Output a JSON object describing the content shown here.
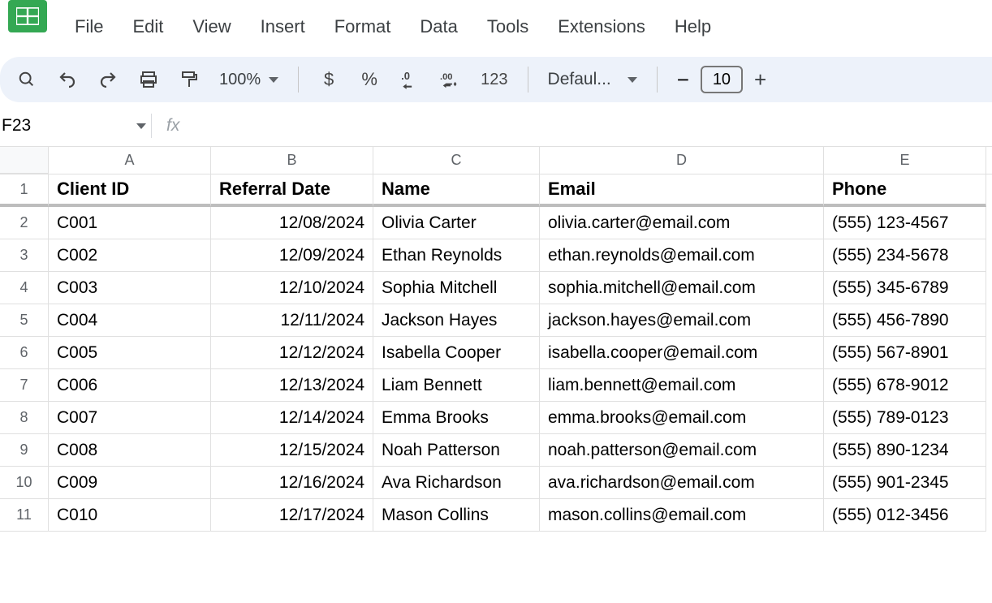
{
  "menu": [
    "File",
    "Edit",
    "View",
    "Insert",
    "Format",
    "Data",
    "Tools",
    "Extensions",
    "Help"
  ],
  "toolbar": {
    "zoom": "100%",
    "currency": "$",
    "percent": "%",
    "number_label": "123",
    "font_name": "Defaul...",
    "font_size": "10",
    "minus": "−",
    "plus": "+"
  },
  "namebox": {
    "cell_ref": "F23",
    "fx_label": "fx"
  },
  "columns": [
    "A",
    "B",
    "C",
    "D",
    "E"
  ],
  "header_row": [
    "Client ID",
    "Referral Date",
    "Name",
    "Email",
    "Phone"
  ],
  "rows": [
    {
      "n": "2",
      "a": "C001",
      "b": "12/08/2024",
      "c": "Olivia Carter",
      "d": "olivia.carter@email.com",
      "e": "(555) 123-4567"
    },
    {
      "n": "3",
      "a": "C002",
      "b": "12/09/2024",
      "c": "Ethan Reynolds",
      "d": "ethan.reynolds@email.com",
      "e": "(555) 234-5678"
    },
    {
      "n": "4",
      "a": "C003",
      "b": "12/10/2024",
      "c": "Sophia Mitchell",
      "d": "sophia.mitchell@email.com",
      "e": "(555) 345-6789"
    },
    {
      "n": "5",
      "a": "C004",
      "b": "12/11/2024",
      "c": "Jackson Hayes",
      "d": "jackson.hayes@email.com",
      "e": "(555) 456-7890"
    },
    {
      "n": "6",
      "a": "C005",
      "b": "12/12/2024",
      "c": "Isabella Cooper",
      "d": "isabella.cooper@email.com",
      "e": "(555) 567-8901"
    },
    {
      "n": "7",
      "a": "C006",
      "b": "12/13/2024",
      "c": "Liam Bennett",
      "d": "liam.bennett@email.com",
      "e": "(555) 678-9012"
    },
    {
      "n": "8",
      "a": "C007",
      "b": "12/14/2024",
      "c": "Emma Brooks",
      "d": "emma.brooks@email.com",
      "e": "(555) 789-0123"
    },
    {
      "n": "9",
      "a": "C008",
      "b": "12/15/2024",
      "c": "Noah Patterson",
      "d": "noah.patterson@email.com",
      "e": "(555) 890-1234"
    },
    {
      "n": "10",
      "a": "C009",
      "b": "12/16/2024",
      "c": "Ava Richardson",
      "d": "ava.richardson@email.com",
      "e": "(555) 901-2345"
    },
    {
      "n": "11",
      "a": "C010",
      "b": "12/17/2024",
      "c": "Mason Collins",
      "d": "mason.collins@email.com",
      "e": "(555) 012-3456"
    }
  ],
  "header_row_num": "1"
}
